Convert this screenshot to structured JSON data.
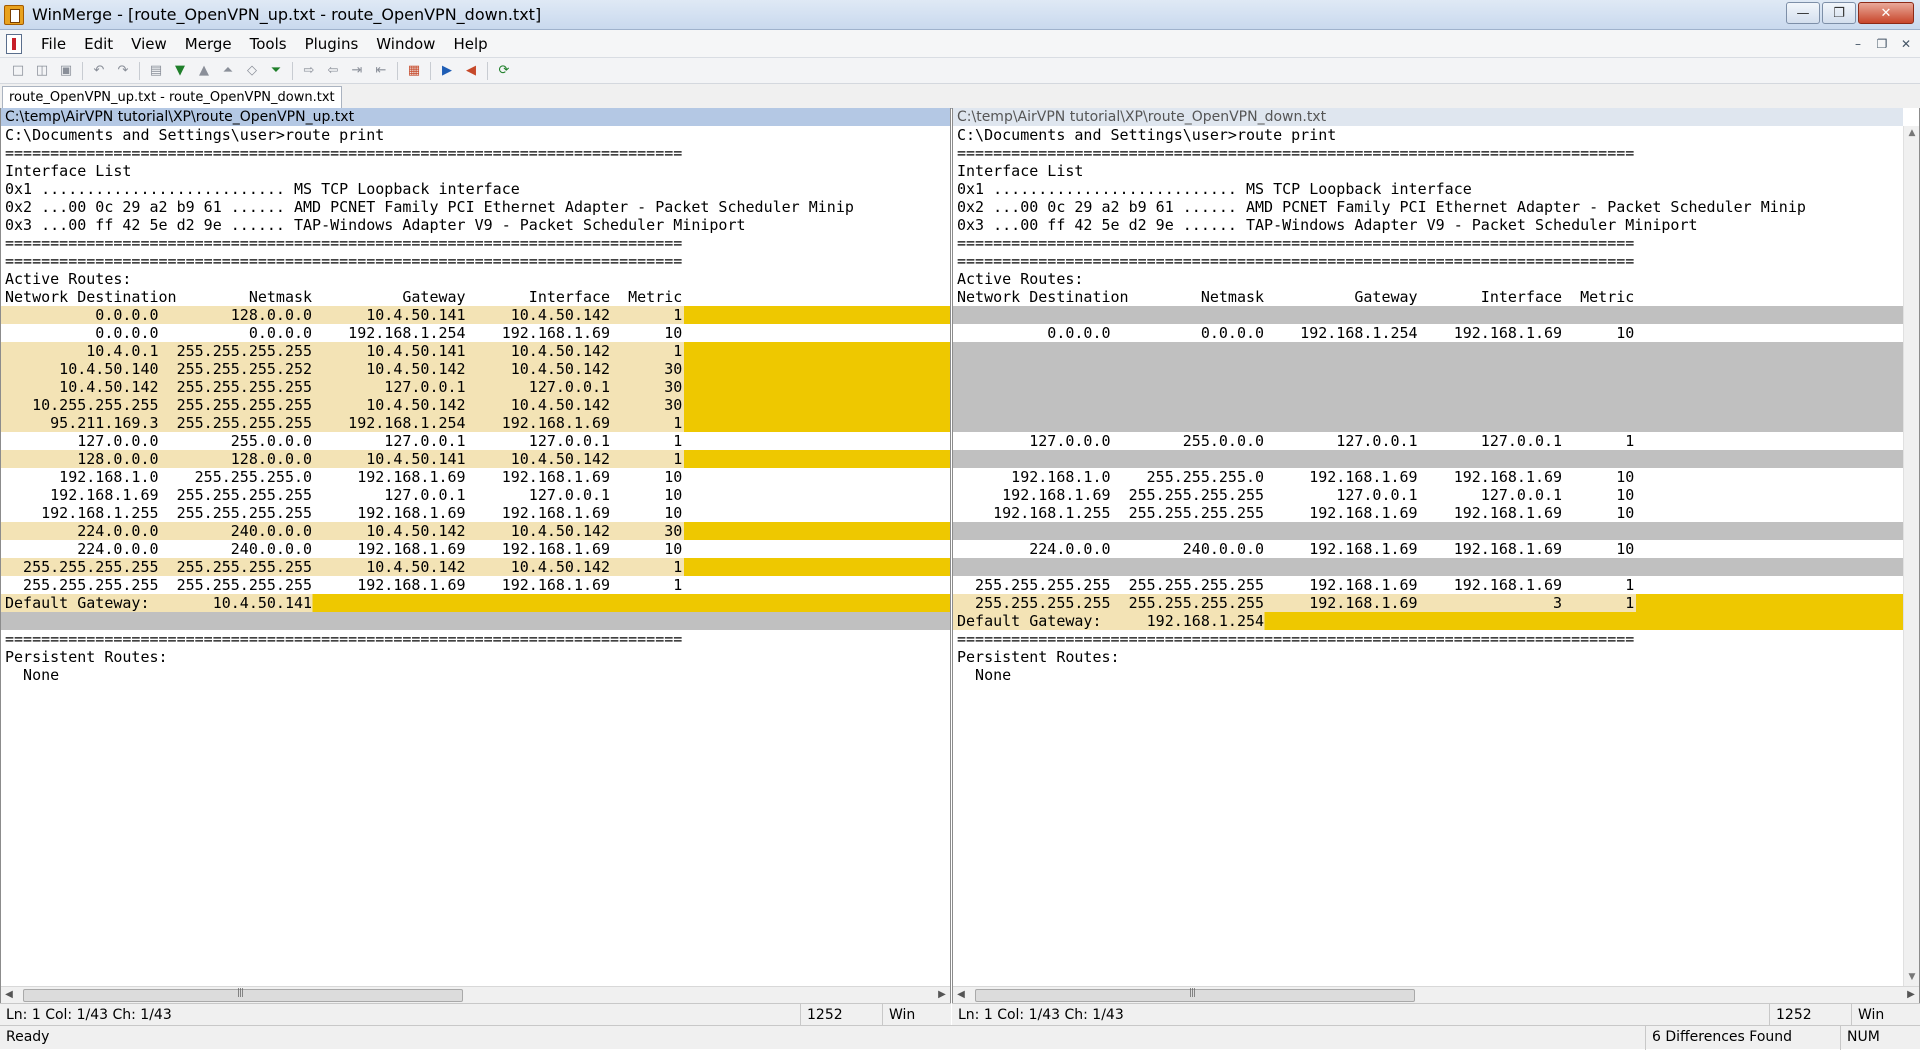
{
  "window": {
    "title": "WinMerge - [route_OpenVPN_up.txt - route_OpenVPN_down.txt]",
    "buttons": [
      "minimize",
      "maximize",
      "close"
    ]
  },
  "menu": [
    "File",
    "Edit",
    "View",
    "Merge",
    "Tools",
    "Plugins",
    "Window",
    "Help"
  ],
  "tab": {
    "label": "route_OpenVPN_up.txt - route_OpenVPN_down.txt"
  },
  "left": {
    "path": "C:\\temp\\AirVPN tutorial\\XP\\route_OpenVPN_up.txt",
    "lines": [
      {
        "t": "C:\\Documents and Settings\\user>route print",
        "k": "n"
      },
      {
        "t": "===========================================================================",
        "k": "n"
      },
      {
        "t": "Interface List",
        "k": "n"
      },
      {
        "t": "0x1 ........................... MS TCP Loopback interface",
        "k": "n"
      },
      {
        "t": "0x2 ...00 0c 29 a2 b9 61 ...... AMD PCNET Family PCI Ethernet Adapter - Packet Scheduler Minip",
        "k": "n"
      },
      {
        "t": "0x3 ...00 ff 42 5e d2 9e ...... TAP-Windows Adapter V9 - Packet Scheduler Miniport",
        "k": "n"
      },
      {
        "t": "===========================================================================",
        "k": "n"
      },
      {
        "t": "===========================================================================",
        "k": "n"
      },
      {
        "t": "Active Routes:",
        "k": "n"
      },
      {
        "t": "Network Destination        Netmask          Gateway       Interface  Metric",
        "k": "n"
      },
      {
        "t": "          0.0.0.0        128.0.0.0      10.4.50.141     10.4.50.142       1",
        "k": "d"
      },
      {
        "t": "          0.0.0.0          0.0.0.0    192.168.1.254    192.168.1.69      10",
        "k": "n"
      },
      {
        "t": "         10.4.0.1  255.255.255.255      10.4.50.141     10.4.50.142       1",
        "k": "d"
      },
      {
        "t": "      10.4.50.140  255.255.255.252      10.4.50.142     10.4.50.142      30",
        "k": "d"
      },
      {
        "t": "      10.4.50.142  255.255.255.255        127.0.0.1       127.0.0.1      30",
        "k": "d"
      },
      {
        "t": "   10.255.255.255  255.255.255.255      10.4.50.142     10.4.50.142      30",
        "k": "d"
      },
      {
        "t": "     95.211.169.3  255.255.255.255    192.168.1.254    192.168.1.69       1",
        "k": "d"
      },
      {
        "t": "        127.0.0.0        255.0.0.0        127.0.0.1       127.0.0.1       1",
        "k": "n"
      },
      {
        "t": "        128.0.0.0        128.0.0.0      10.4.50.141     10.4.50.142       1",
        "k": "d"
      },
      {
        "t": "      192.168.1.0    255.255.255.0     192.168.1.69    192.168.1.69      10",
        "k": "n"
      },
      {
        "t": "     192.168.1.69  255.255.255.255        127.0.0.1       127.0.0.1      10",
        "k": "n"
      },
      {
        "t": "    192.168.1.255  255.255.255.255     192.168.1.69    192.168.1.69      10",
        "k": "n"
      },
      {
        "t": "        224.0.0.0        240.0.0.0      10.4.50.142     10.4.50.142      30",
        "k": "d"
      },
      {
        "t": "        224.0.0.0        240.0.0.0     192.168.1.69    192.168.1.69      10",
        "k": "n"
      },
      {
        "t": "  255.255.255.255  255.255.255.255      10.4.50.142     10.4.50.142       1",
        "k": "d"
      },
      {
        "t": "  255.255.255.255  255.255.255.255     192.168.1.69    192.168.1.69       1",
        "k": "n"
      },
      {
        "t": "Default Gateway:       10.4.50.141",
        "k": "d"
      },
      {
        "t": "",
        "k": "g"
      },
      {
        "t": "===========================================================================",
        "k": "n"
      },
      {
        "t": "Persistent Routes:",
        "k": "n"
      },
      {
        "t": "  None",
        "k": "n"
      }
    ]
  },
  "right": {
    "path": "C:\\temp\\AirVPN tutorial\\XP\\route_OpenVPN_down.txt",
    "lines": [
      {
        "t": "C:\\Documents and Settings\\user>route print",
        "k": "n"
      },
      {
        "t": "===========================================================================",
        "k": "n"
      },
      {
        "t": "Interface List",
        "k": "n"
      },
      {
        "t": "0x1 ........................... MS TCP Loopback interface",
        "k": "n"
      },
      {
        "t": "0x2 ...00 0c 29 a2 b9 61 ...... AMD PCNET Family PCI Ethernet Adapter - Packet Scheduler Minip",
        "k": "n"
      },
      {
        "t": "0x3 ...00 ff 42 5e d2 9e ...... TAP-Windows Adapter V9 - Packet Scheduler Miniport",
        "k": "n"
      },
      {
        "t": "===========================================================================",
        "k": "n"
      },
      {
        "t": "===========================================================================",
        "k": "n"
      },
      {
        "t": "Active Routes:",
        "k": "n"
      },
      {
        "t": "Network Destination        Netmask          Gateway       Interface  Metric",
        "k": "n"
      },
      {
        "t": "",
        "k": "g"
      },
      {
        "t": "          0.0.0.0          0.0.0.0    192.168.1.254    192.168.1.69      10",
        "k": "n"
      },
      {
        "t": "",
        "k": "g"
      },
      {
        "t": "",
        "k": "g"
      },
      {
        "t": "",
        "k": "g"
      },
      {
        "t": "",
        "k": "g"
      },
      {
        "t": "",
        "k": "g"
      },
      {
        "t": "        127.0.0.0        255.0.0.0        127.0.0.1       127.0.0.1       1",
        "k": "n"
      },
      {
        "t": "",
        "k": "g"
      },
      {
        "t": "      192.168.1.0    255.255.255.0     192.168.1.69    192.168.1.69      10",
        "k": "n"
      },
      {
        "t": "     192.168.1.69  255.255.255.255        127.0.0.1       127.0.0.1      10",
        "k": "n"
      },
      {
        "t": "    192.168.1.255  255.255.255.255     192.168.1.69    192.168.1.69      10",
        "k": "n"
      },
      {
        "t": "",
        "k": "g"
      },
      {
        "t": "        224.0.0.0        240.0.0.0     192.168.1.69    192.168.1.69      10",
        "k": "n"
      },
      {
        "t": "",
        "k": "g"
      },
      {
        "t": "  255.255.255.255  255.255.255.255     192.168.1.69    192.168.1.69       1",
        "k": "n"
      },
      {
        "t": "  255.255.255.255  255.255.255.255     192.168.1.69               3       1",
        "k": "d"
      },
      {
        "t": "Default Gateway:     192.168.1.254",
        "k": "d"
      },
      {
        "t": "===========================================================================",
        "k": "n"
      },
      {
        "t": "Persistent Routes:",
        "k": "n"
      },
      {
        "t": "  None",
        "k": "n"
      }
    ]
  },
  "pane_status": {
    "left": {
      "position": "Ln: 1  Col: 1/43  Ch: 1/43",
      "codepage": "1252",
      "eol": "Win"
    },
    "right": {
      "position": "Ln: 1  Col: 1/43  Ch: 1/43",
      "codepage": "1252",
      "eol": "Win"
    }
  },
  "status": {
    "text": "Ready",
    "differences": "6 Differences Found",
    "num": "NUM"
  },
  "colors": {
    "diff_text_bg": "#f3e3b5",
    "diff_fill": "#eec800",
    "gap": "#c0c0c0",
    "active_header": "#b4c8e4"
  }
}
